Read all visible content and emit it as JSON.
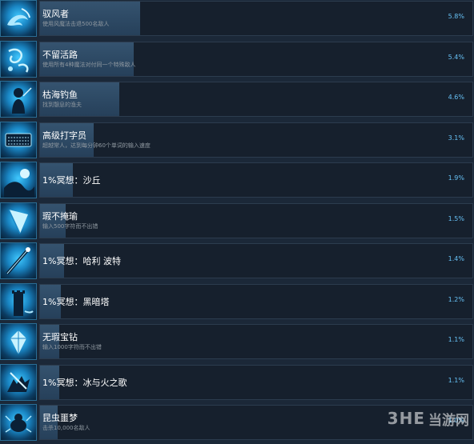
{
  "achievements": [
    {
      "name": "驭风者",
      "description": "使用风魔法击退500名敌人",
      "percent": "5.8%",
      "progress": 5.8,
      "icon": "wind-swirl-icon"
    },
    {
      "name": "不留活路",
      "description": "使用所有4种魔法对付同一个特殊敌人",
      "percent": "5.4%",
      "progress": 5.4,
      "icon": "magic-swirl-icon"
    },
    {
      "name": "枯海钓鱼",
      "description": "找到憩息的渔夫",
      "percent": "4.6%",
      "progress": 4.6,
      "icon": "fisherman-icon"
    },
    {
      "name": "高级打字员",
      "description": "超越常人，达到每分钟60个单词的输入速度",
      "percent": "3.1%",
      "progress": 3.1,
      "icon": "keyboard-icon"
    },
    {
      "name": "1%冥想：沙丘",
      "description": "",
      "percent": "1.9%",
      "progress": 1.9,
      "icon": "sand-dune-icon"
    },
    {
      "name": "瑕不掩瑜",
      "description": "输入500字符而不出错",
      "percent": "1.5%",
      "progress": 1.5,
      "icon": "crystal-icon"
    },
    {
      "name": "1%冥想：哈利 波特",
      "description": "",
      "percent": "1.4%",
      "progress": 1.4,
      "icon": "wand-icon"
    },
    {
      "name": "1%冥想：黑暗塔",
      "description": "",
      "percent": "1.2%",
      "progress": 1.2,
      "icon": "tower-icon"
    },
    {
      "name": "无瑕宝钻",
      "description": "输入1000字符而不出错",
      "percent": "1.1%",
      "progress": 1.1,
      "icon": "gem-icon"
    },
    {
      "name": "1%冥想：冰与火之歌",
      "description": "",
      "percent": "1.1%",
      "progress": 1.1,
      "icon": "wolf-icon"
    },
    {
      "name": "昆虫噩梦",
      "description": "击杀10,000名敌人",
      "percent": "1.0%",
      "progress": 1.0,
      "icon": "insect-icon"
    }
  ],
  "watermark": {
    "logo": "3HE",
    "text": "当游网"
  },
  "colors": {
    "background": "#1b2838",
    "panel": "#16202d",
    "progress": "#2f4b66",
    "percent_text": "#66c0f4",
    "description_text": "#8f98a0"
  }
}
